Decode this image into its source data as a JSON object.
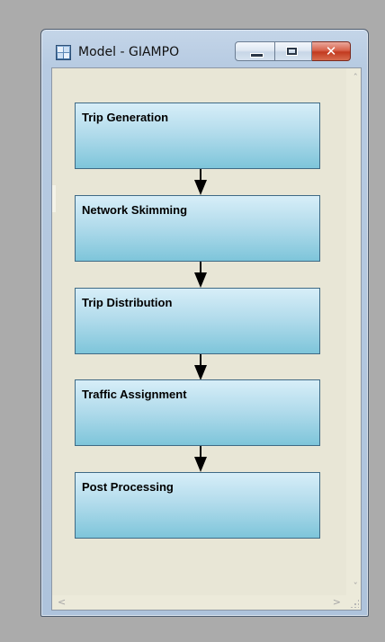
{
  "window": {
    "title": "Model - GIAMPO",
    "close_glyph": "✕",
    "icons": {
      "app": "model-grid-icon",
      "minimize": "minimize-icon",
      "maximize": "maximize-icon",
      "close": "close-icon"
    }
  },
  "scrollbars": {
    "up": "ˆ",
    "down": "ˇ",
    "left": "<",
    "right": ">"
  },
  "diagram": {
    "stages": [
      {
        "label": "Trip Generation"
      },
      {
        "label": "Network Skimming"
      },
      {
        "label": "Trip Distribution"
      },
      {
        "label": "Traffic Assignment"
      },
      {
        "label": "Post Processing"
      }
    ]
  },
  "colors": {
    "stage_top": "#d7eef8",
    "stage_bottom": "#7ec5da",
    "canvas": "#e8e6d6",
    "close_button": "#c23a1f"
  }
}
